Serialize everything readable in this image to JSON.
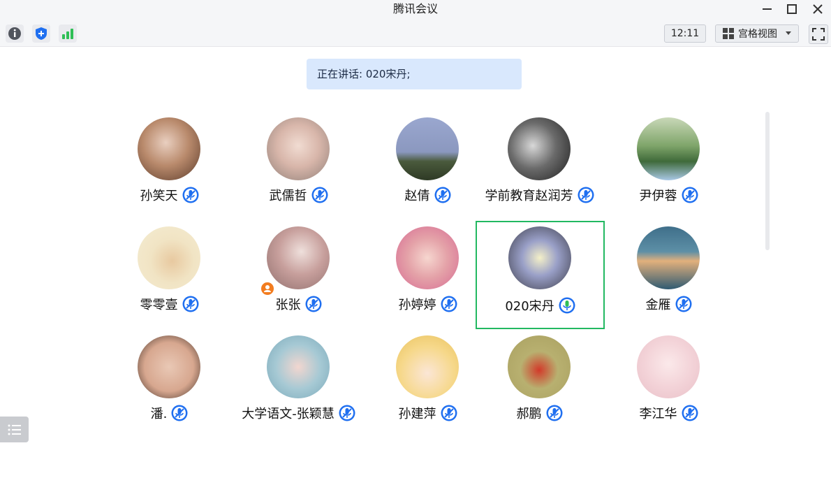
{
  "window": {
    "title": "腾讯会议"
  },
  "toolbar": {
    "clock": "12:11",
    "view_mode": "宫格视图"
  },
  "speaking": {
    "label": "正在讲话: 020宋丹;"
  },
  "participants": [
    {
      "name": "孙笑天",
      "mic": "muted"
    },
    {
      "name": "武儒哲",
      "mic": "muted"
    },
    {
      "name": "赵倩",
      "mic": "muted"
    },
    {
      "name": "学前教育赵润芳",
      "mic": "muted"
    },
    {
      "name": "尹伊蓉",
      "mic": "muted"
    },
    {
      "name": "零零壹",
      "mic": "muted"
    },
    {
      "name": "张张",
      "mic": "muted",
      "host_badge": true
    },
    {
      "name": "孙婷婷",
      "mic": "muted"
    },
    {
      "name": "020宋丹",
      "mic": "speaking",
      "active": true
    },
    {
      "name": "金雁",
      "mic": "muted"
    },
    {
      "name": "潘.",
      "mic": "muted"
    },
    {
      "name": "大学语文-张颖慧",
      "mic": "muted"
    },
    {
      "name": "孙建萍",
      "mic": "muted"
    },
    {
      "name": "郝鹏",
      "mic": "muted"
    },
    {
      "name": "李江华",
      "mic": "muted"
    }
  ],
  "colors": {
    "accent": "#1f6ff0",
    "speaking": "#2fbf56",
    "active_border": "#22b861",
    "badge": "#f27c1f"
  }
}
